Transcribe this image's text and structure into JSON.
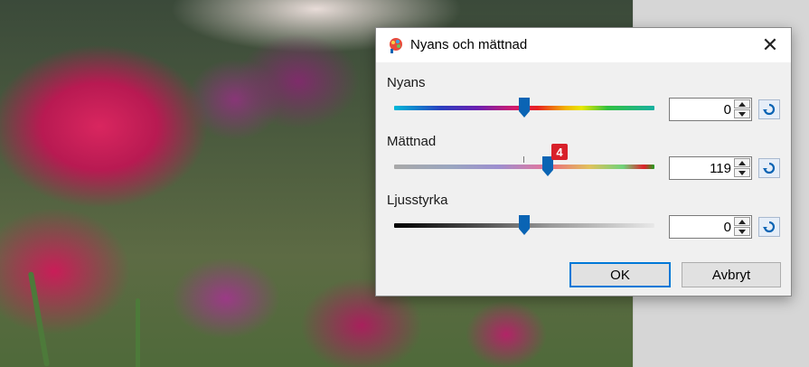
{
  "dialog": {
    "title": "Nyans och mättnad",
    "close_glyph": "✕",
    "icons": {
      "app": "palette-icon",
      "close": "close-icon",
      "reset": "reset-arrow-icon"
    },
    "sliders": {
      "hue": {
        "label": "Nyans",
        "value": "0",
        "position_fraction": 0.5
      },
      "saturation": {
        "label": "Mättnad",
        "value": "119",
        "position_fraction": 0.59,
        "badge": "4"
      },
      "lightness": {
        "label": "Ljusstyrka",
        "value": "0",
        "position_fraction": 0.5
      }
    },
    "buttons": {
      "ok": "OK",
      "cancel": "Avbryt"
    }
  },
  "colors": {
    "thumb": "#0a64b4",
    "badge": "#d8202a",
    "ok_focus": "#0078d7"
  }
}
